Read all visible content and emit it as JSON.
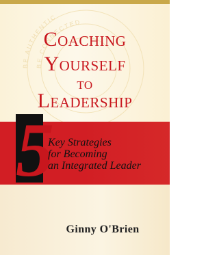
{
  "cover": {
    "title_lines": [
      "Coaching",
      "Yourself",
      "to",
      "Leadership"
    ],
    "number": "5",
    "subtitle_lines": [
      "Key Strategies",
      "for Becoming",
      "an Integrated Leader"
    ],
    "author": "Ginny O'Brien",
    "ring_texts": [
      "BE AUTHENTIC",
      "BE CONNECTED",
      "BE EMOTIONAL",
      "BE INTUITIVE"
    ]
  },
  "colors": {
    "title_red": "#c8161d",
    "band_red": "#d21e24",
    "number_box": "#111111",
    "cream": "#fbf2d8",
    "gold_rule": "#c9a84a"
  }
}
